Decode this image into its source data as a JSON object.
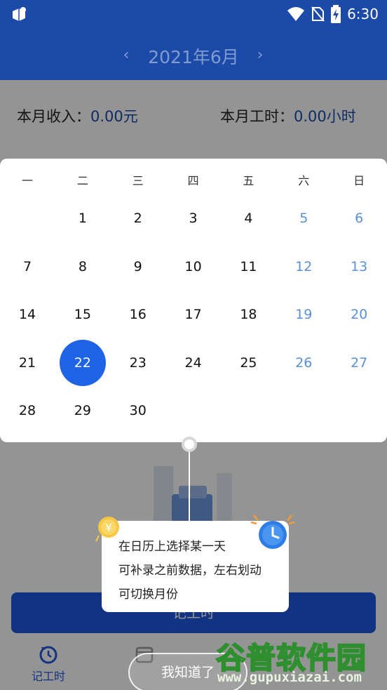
{
  "status_bar": {
    "time": "6:30",
    "icons": [
      "app-icon",
      "wifi-icon",
      "no-sim-icon",
      "battery-charging-icon"
    ]
  },
  "header": {
    "month_title": "2021年6月",
    "prev_icon": "‹",
    "next_icon": "›"
  },
  "summary": {
    "income_label": "本月收入：",
    "income_value": "0.00元",
    "hours_label": "本月工时：",
    "hours_value": "0.00小时"
  },
  "calendar": {
    "weekdays": [
      "一",
      "二",
      "三",
      "四",
      "五",
      "六",
      "日"
    ],
    "rows": [
      [
        "",
        "1",
        "2",
        "3",
        "4",
        "5",
        "6"
      ],
      [
        "7",
        "8",
        "9",
        "10",
        "11",
        "12",
        "13"
      ],
      [
        "14",
        "15",
        "16",
        "17",
        "18",
        "19",
        "20"
      ],
      [
        "21",
        "22",
        "23",
        "24",
        "25",
        "26",
        "27"
      ],
      [
        "28",
        "29",
        "30",
        "",
        "",
        "",
        ""
      ]
    ],
    "selected_day": "22",
    "colors": {
      "selected": "#1f63e6",
      "weekend": "#5b8fd6",
      "header": "#1c4aa8"
    }
  },
  "tooltip": {
    "line1": "在日历上选择某一天",
    "line2": "可补录之前数据，左右划动",
    "line3": "可切换月份",
    "coin_symbol": "¥",
    "decor_icons": [
      "coin-icon",
      "alarm-clock-icon"
    ]
  },
  "main_button": {
    "label": "记工时"
  },
  "got_it_button": {
    "label": "我知道了"
  },
  "bottom_nav": {
    "record_label": "记工时"
  },
  "watermark": {
    "title": "谷普软件园",
    "url": "www.gupuxiazai.com"
  }
}
